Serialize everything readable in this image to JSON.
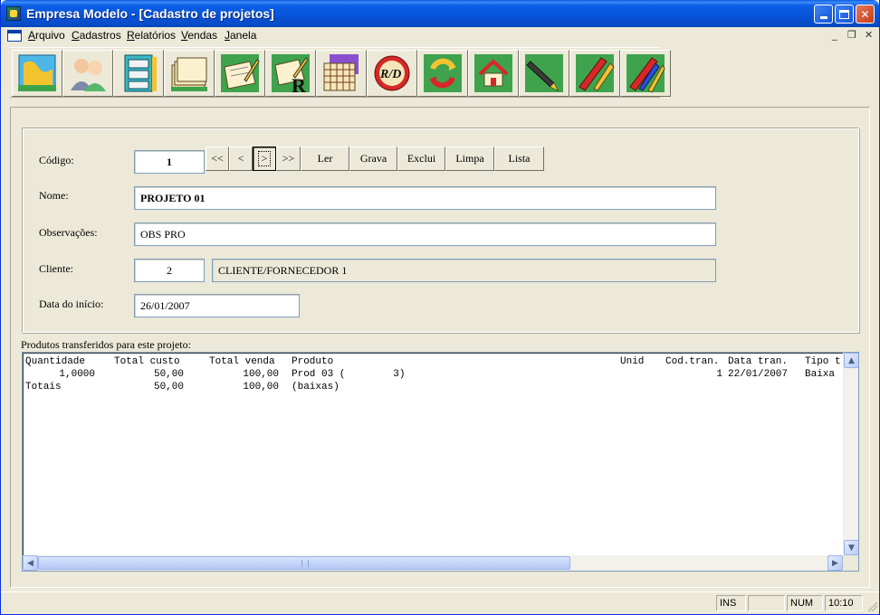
{
  "window": {
    "title": "Empresa Modelo - [Cadastro de projetos]"
  },
  "menu": {
    "items": [
      "Arquivo",
      "Cadastros",
      "Relatórios",
      "Vendas",
      "Janela"
    ]
  },
  "toolbar": {
    "buttons": [
      "map-icon",
      "users-icon",
      "cabinet-icon",
      "folders-icon",
      "edit-document-icon",
      "report-icon",
      "calendar-grid-icon",
      "rd-icon",
      "refresh-icon",
      "home-icon",
      "pen-icon",
      "red-pencil-icon",
      "blue-pencil-icon"
    ]
  },
  "form": {
    "codigo": {
      "label": "Código:",
      "value": "1"
    },
    "nome": {
      "label": "Nome:",
      "value": "PROJETO 01"
    },
    "observacoes": {
      "label": "Observações:",
      "value": "OBS PRO"
    },
    "cliente": {
      "label": "Cliente:",
      "code": "2",
      "name": "CLIENTE/FORNECEDOR 1"
    },
    "data_inicio": {
      "label": "Data do início:",
      "value": "26/01/2007"
    }
  },
  "nav": {
    "first": "<<",
    "prev": "<",
    "next": ">",
    "last": ">>",
    "ler": "Ler",
    "grava": "Grava",
    "exclui": "Exclui",
    "limpa": "Limpa",
    "lista": "Lista"
  },
  "list": {
    "label": "Produtos transferidos para este projeto:",
    "headers": {
      "quantidade": "Quantidade",
      "total_custo": "Total custo",
      "total_venda": "Total venda",
      "produto": "Produto",
      "unid": "Unid",
      "cod_tran": "Cod.tran.",
      "data_tran": "Data tran.",
      "tipo": "Tipo t"
    },
    "rows": [
      {
        "quantidade": "1,0000",
        "total_custo": "50,00",
        "total_venda": "100,00",
        "produto": "Prod 03 (        3)",
        "unid": "",
        "cod_tran": "1",
        "data_tran": "22/01/2007",
        "tipo": "Baixa"
      },
      {
        "quantidade": "Totais",
        "total_custo": "50,00",
        "total_venda": "100,00",
        "produto": "(baixas)",
        "unid": "",
        "cod_tran": "",
        "data_tran": "",
        "tipo": ""
      }
    ]
  },
  "status": {
    "ins": "INS",
    "num": "NUM",
    "time": "10:10"
  }
}
